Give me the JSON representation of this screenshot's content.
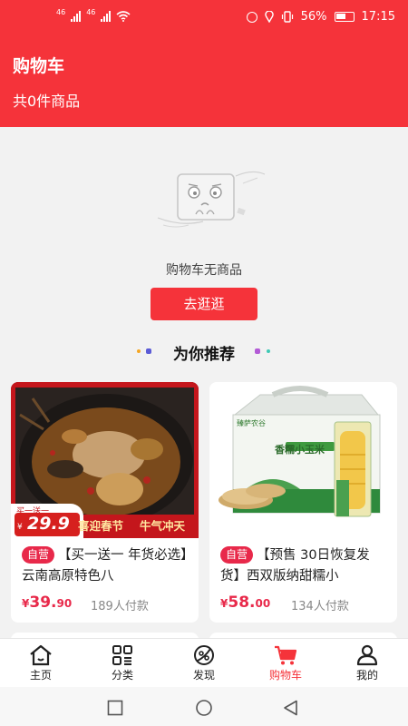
{
  "status_bar": {
    "signal1": "46",
    "signal2": "46",
    "battery": "56%",
    "time": "17:15"
  },
  "header": {
    "title": "购物车",
    "count_text": "共0件商品"
  },
  "empty": {
    "message": "购物车无商品",
    "button_label": "去逛逛"
  },
  "recommend": {
    "title": "为你推荐"
  },
  "products": [
    {
      "tag": "自营",
      "name": "【买一送一 年货必选】云南高原特色八",
      "price_symbol": "¥",
      "price_int": "39.",
      "price_dec": "90",
      "sold": "189人付款",
      "promo_small": "买一送一",
      "promo_price_symbol": "¥",
      "promo_price": "29.9",
      "promo_banner_left": "喜迎春节",
      "promo_banner_right": "牛气冲天"
    },
    {
      "tag": "自营",
      "name": "【预售 30日恢复发货】西双版纳甜糯小",
      "price_symbol": "¥",
      "price_int": "58.",
      "price_dec": "00",
      "sold": "134人付款",
      "box_brand": "臻萨农谷",
      "bag_text": "香糯小玉米"
    }
  ],
  "tabs": [
    {
      "label": "主页",
      "icon": "home-icon"
    },
    {
      "label": "分类",
      "icon": "category-icon"
    },
    {
      "label": "发现",
      "icon": "discover-icon"
    },
    {
      "label": "购物车",
      "icon": "cart-icon",
      "active": true
    },
    {
      "label": "我的",
      "icon": "user-icon"
    }
  ],
  "colors": {
    "brand_red": "#f5333a",
    "price_red": "#e8294a"
  }
}
